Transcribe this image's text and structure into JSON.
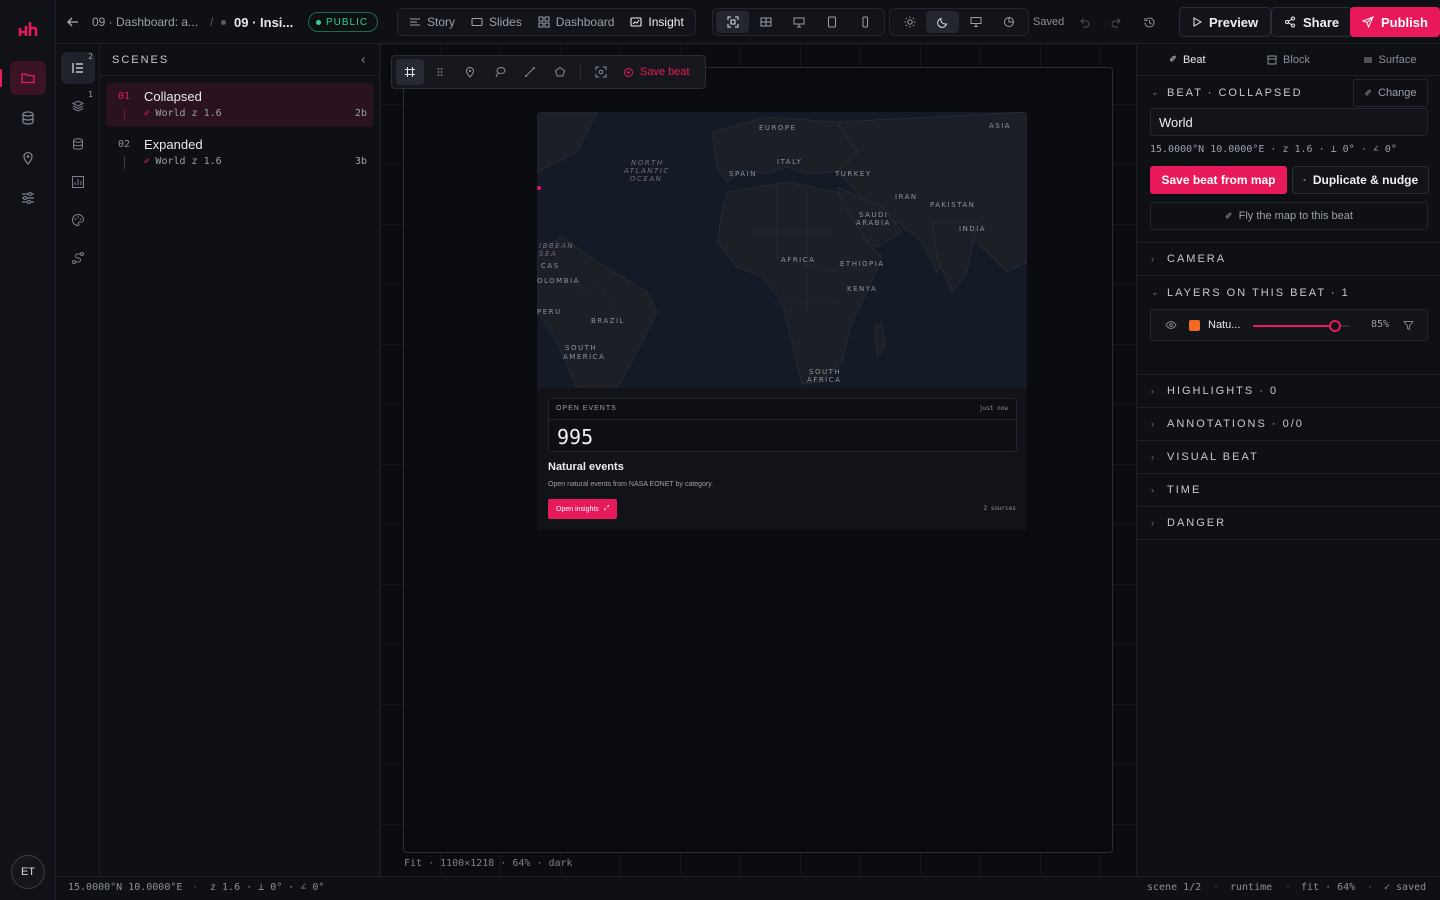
{
  "topbar": {
    "breadcrumb_parent": "09 · Dashboard: a...",
    "breadcrumb_sep": "/",
    "breadcrumb_current": "09 · Insi...",
    "visibility": "PUBLIC",
    "modes": [
      "Story",
      "Slides",
      "Dashboard",
      "Insight"
    ],
    "active_mode": "Insight",
    "saved_label": "Saved",
    "preview": "Preview",
    "share": "Share",
    "publish": "Publish"
  },
  "tool_badges": {
    "scenes": "2",
    "layers": "1"
  },
  "scenes_panel": {
    "title": "SCENES",
    "items": [
      {
        "num": "01",
        "title": "Collapsed",
        "base": "World",
        "zoom": "z 1.6",
        "count": "2b",
        "active": true
      },
      {
        "num": "02",
        "title": "Expanded",
        "base": "World",
        "zoom": "z 1.6",
        "count": "3b",
        "active": false
      }
    ]
  },
  "canvas": {
    "toolbar_save": "Save beat",
    "footer": "Fit · 1100×1218 · 64% · dark",
    "map_labels": [
      "EUROPE",
      "ASIA",
      "ITALY",
      "SPAIN",
      "TURKEY",
      "IRAN",
      "PAKISTAN",
      "INDIA",
      "SAUDI",
      "ARABIA",
      "AFRICA",
      "ETHIOPIA",
      "KENYA",
      "NORTH",
      "ATLANTIC",
      "OCEAN",
      "IBBEAN",
      "SEA",
      "CAS",
      "OLOMBIA",
      "PERU",
      "BRAZIL",
      "SOUTH",
      "AMERICA",
      "SOUTH",
      "AFRICA"
    ],
    "card": {
      "stat_label": "OPEN EVENTS",
      "stat_time": "just now",
      "stat_value": "995",
      "title": "Natural events",
      "description": "Open natural events from NASA EONET by category.",
      "button": "Open insights",
      "sources": "2 sources"
    }
  },
  "inspector": {
    "tabs": [
      "Beat",
      "Block",
      "Surface"
    ],
    "active_tab": "Beat",
    "beat_header": "BEAT · COLLAPSED",
    "change": "Change",
    "base_value": "World",
    "coords": "15.0000°N 10.0000°E · z 1.6 · ⊥ 0° · ∠ 0°",
    "save_from_map": "Save beat from map",
    "duplicate": "Duplicate & nudge",
    "fly": "Fly the map to this beat",
    "camera": "CAMERA",
    "layers_header": "LAYERS ON THIS BEAT · 1",
    "layer": {
      "name": "Natu...",
      "opacity_label": "85%",
      "opacity": 0.85,
      "color": "#f06a22"
    },
    "highlights": "HIGHLIGHTS · 0",
    "annotations": "ANNOTATIONS · 0/0",
    "visual_beat": "VISUAL BEAT",
    "time": "TIME",
    "danger": "DANGER"
  },
  "statusbar": {
    "coords": "15.0000°N 10.0000°E",
    "camera": "z 1.6 · ⊥ 0° · ∠ 0°",
    "scene": "scene 1/2",
    "runtime": "runtime",
    "fit": "fit · 64%",
    "saved": "✓ saved"
  },
  "colors": {
    "accent": "#e8195a",
    "public": "#35d08a",
    "layer": "#f06a22"
  }
}
